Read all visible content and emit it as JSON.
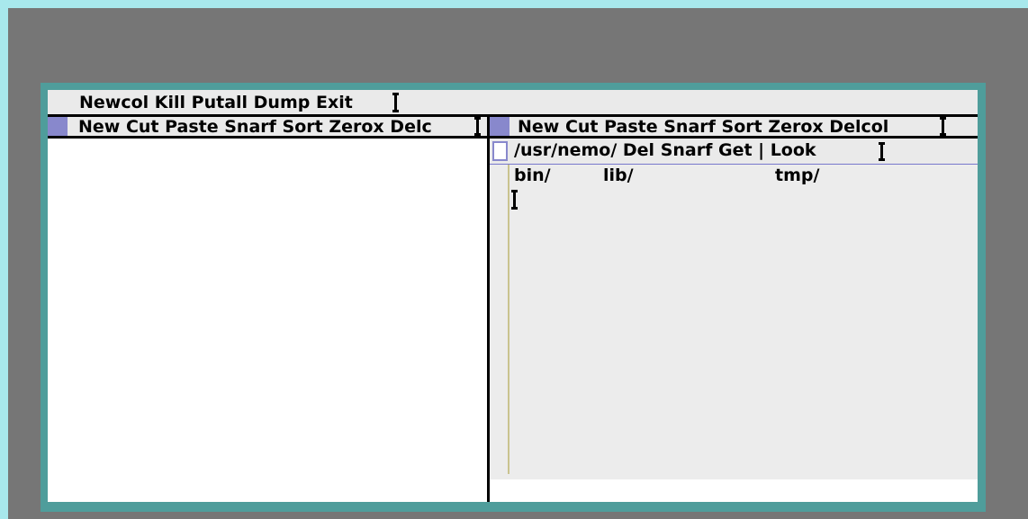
{
  "row_tag": {
    "text": "Newcol Kill Putall Dump Exit"
  },
  "columns": [
    {
      "tag": "New Cut Paste Snarf Sort Zerox Delc"
    },
    {
      "tag": "New Cut Paste Snarf Sort Zerox Delcol"
    }
  ],
  "window": {
    "tag": "/usr/nemo/ Del Snarf Get | Look",
    "entries": [
      "bin/",
      "lib/",
      "tmp/"
    ]
  },
  "colors": {
    "screen_border": "#a8e8ec",
    "desktop": "#767676",
    "window_border": "#4f9d9b",
    "tag_bg": "#eaeaea",
    "handle": "#8888cc",
    "scrollbar": "#c9c38f"
  }
}
